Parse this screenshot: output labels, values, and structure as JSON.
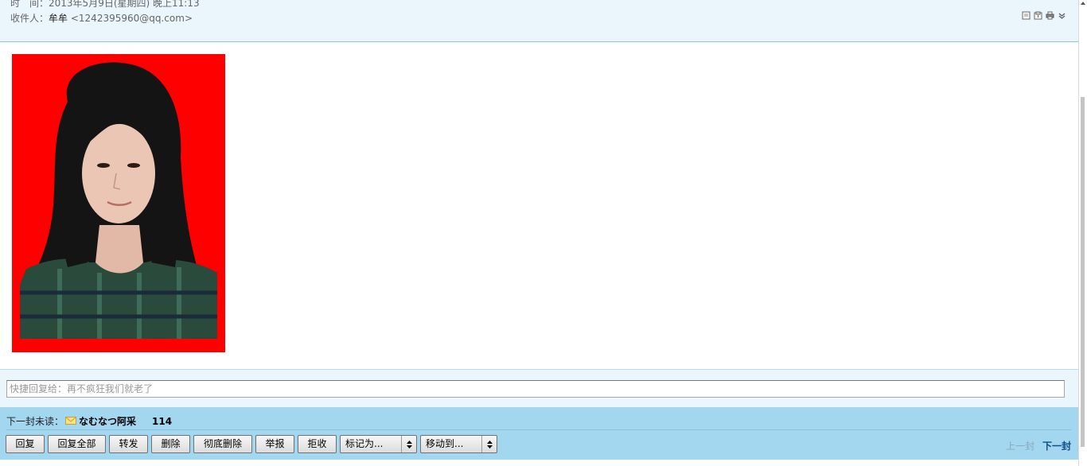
{
  "header": {
    "time_label": "时　间：",
    "time_value": "2013年5月9日(星期四) 晚上11:13",
    "recipient_label": "收件人：",
    "recipient_name": "牟牟",
    "recipient_email": "<1242395960@qq.com>",
    "tool_icons": [
      "note-icon",
      "save-icon",
      "print-icon",
      "chevron-down-icon"
    ]
  },
  "body": {
    "attachment_type": "portrait-photo",
    "photo_background": "#ff0000"
  },
  "quick_reply": {
    "placeholder": "快捷回复给：再不疯狂我们就老了"
  },
  "footer": {
    "next_unread_label": "下一封未读：",
    "next_unread_title": "なむなつ阿采",
    "next_unread_count": "114",
    "buttons": {
      "reply": "回复",
      "reply_all": "回复全部",
      "forward": "转发",
      "delete": "删除",
      "delete_permanently": "彻底删除",
      "report": "举报",
      "reject": "拒收"
    },
    "mark_as": "标记为...",
    "move_to": "移动到...",
    "prev_mail": "上一封",
    "next_mail": "下一封"
  },
  "colors": {
    "header_bg": "#eaf5fc",
    "footer_bg": "#a3d6ef",
    "link_blue": "#0b4f86"
  }
}
